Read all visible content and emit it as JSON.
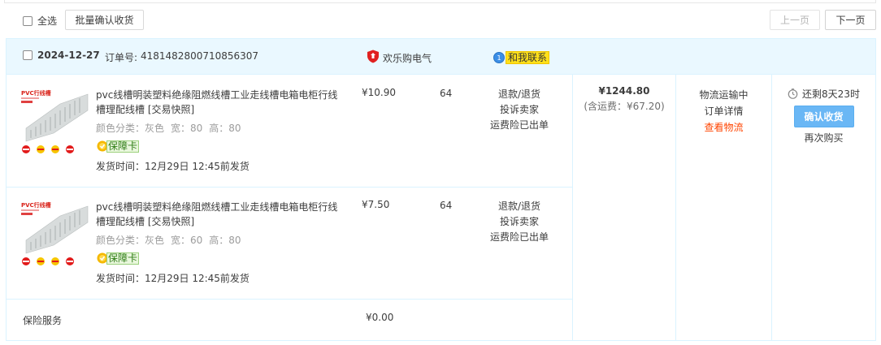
{
  "toolbar": {
    "select_all_label": "全选",
    "batch_confirm_label": "批量确认收货",
    "prev_label": "上一页",
    "next_label": "下一页"
  },
  "order": {
    "date": "2024-12-27",
    "order_no_label": "订单号:",
    "order_no": "4181482800710856307",
    "shop_name": "欢乐购电气",
    "contact_icon_text": "1",
    "contact_label": "和我联系",
    "items": [
      {
        "thumb_title": "PVC行线槽",
        "title": "pvc线槽明装塑料绝缘阻燃线槽工业走线槽电箱电柜行线槽理配线槽 [交易快照]",
        "attr_color": "颜色分类：灰色",
        "attr_width": "宽：80",
        "attr_height": "高：80",
        "badge_label": "保障卡",
        "ship_time": "发货时间：12月29日 12:45前发货",
        "price": "¥10.90",
        "qty": "64",
        "ops": [
          "退款/退货",
          "投诉卖家",
          "运费险已出单"
        ]
      },
      {
        "thumb_title": "PVC行线槽",
        "title": "pvc线槽明装塑料绝缘阻燃线槽工业走线槽电箱电柜行线槽理配线槽 [交易快照]",
        "attr_color": "颜色分类：灰色",
        "attr_width": "宽：60",
        "attr_height": "高：80",
        "badge_label": "保障卡",
        "ship_time": "发货时间：12月29日 12:45前发货",
        "price": "¥7.50",
        "qty": "64",
        "ops": [
          "退款/退货",
          "投诉卖家",
          "运费险已出单"
        ]
      }
    ],
    "insurance_label": "保险服务",
    "insurance_price": "¥0.00",
    "total_amount": "¥1244.80",
    "total_shipping": "(含运费：¥67.20)",
    "status_lines": [
      "物流运输中",
      "订单详情",
      "查看物流"
    ],
    "timer_text": "还剩8天23时",
    "confirm_label": "确认收货",
    "rebuy_label": "再次购买"
  },
  "colors": {
    "accent_blue": "#6ab7f5",
    "header_bg": "#eaf8ff",
    "link_red": "#ff4400",
    "border": "#daf3ff"
  }
}
